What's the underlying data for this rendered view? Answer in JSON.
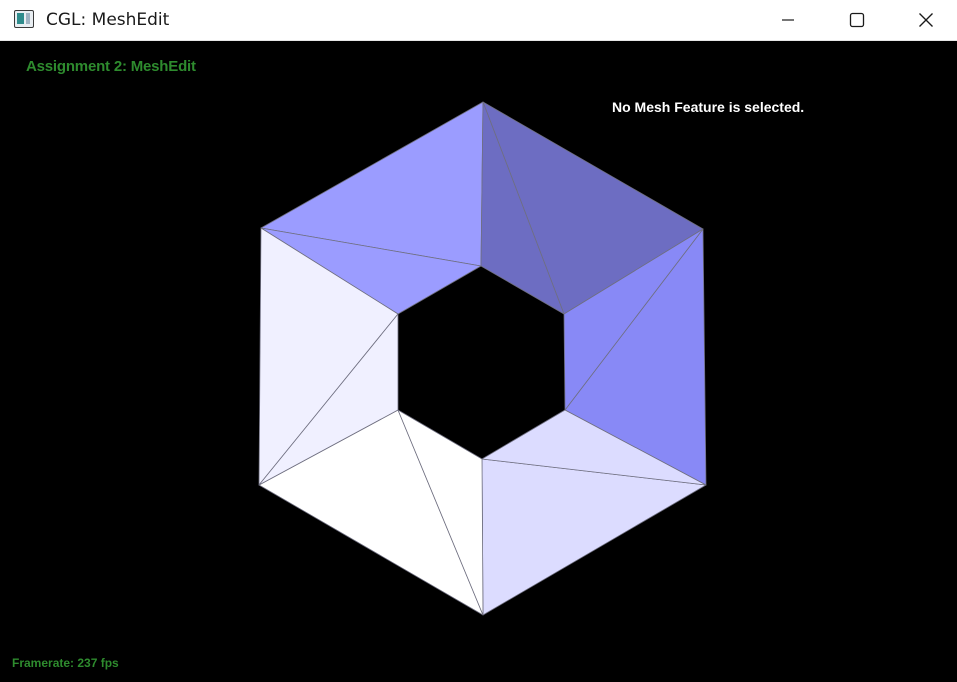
{
  "window": {
    "title": "CGL: MeshEdit",
    "icon": "app-window-icon",
    "controls": {
      "minimize_icon": "minimize-icon",
      "maximize_icon": "maximize-icon",
      "close_icon": "close-icon"
    }
  },
  "viewport": {
    "background": "#000000",
    "assignment_title": "Assignment 2: MeshEdit",
    "assignment_title_color": "#2e8b2e",
    "feature_status": "No Mesh Feature is selected.",
    "framerate": "Framerate: 237 fps",
    "framerate_color": "#2e8b2e"
  },
  "mesh": {
    "edge_color": "#6f6f80",
    "faces": [
      {
        "name": "top-left-face-a",
        "fill": "#9b9cff"
      },
      {
        "name": "top-left-face-b",
        "fill": "#9b9cff"
      },
      {
        "name": "top-left-face-c",
        "fill": "#9b9cff"
      },
      {
        "name": "top-right-face-a",
        "fill": "#6d6dc2"
      },
      {
        "name": "top-right-face-b",
        "fill": "#6d6dc2"
      },
      {
        "name": "right-face-a",
        "fill": "#8889f6"
      },
      {
        "name": "right-face-b",
        "fill": "#8889f6"
      },
      {
        "name": "bottom-right-face-a",
        "fill": "#dcdcff"
      },
      {
        "name": "bottom-right-face-b",
        "fill": "#dcdcff"
      },
      {
        "name": "bottom-left-face-a",
        "fill": "#ffffff"
      },
      {
        "name": "bottom-left-face-b",
        "fill": "#ffffff"
      },
      {
        "name": "left-face-a",
        "fill": "#f0f0ff"
      },
      {
        "name": "left-face-b",
        "fill": "#f0f0ff"
      }
    ]
  }
}
